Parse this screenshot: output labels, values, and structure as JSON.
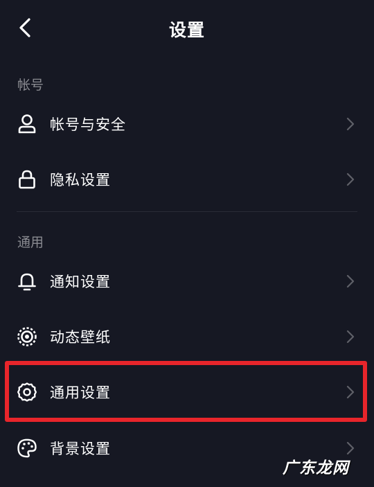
{
  "header": {
    "title": "设置"
  },
  "sections": {
    "account": {
      "label": "帐号",
      "items": [
        {
          "label": "帐号与安全",
          "icon": "user-icon"
        },
        {
          "label": "隐私设置",
          "icon": "lock-icon"
        }
      ]
    },
    "general": {
      "label": "通用",
      "items": [
        {
          "label": "通知设置",
          "icon": "bell-icon"
        },
        {
          "label": "动态壁纸",
          "icon": "live-wallpaper-icon"
        },
        {
          "label": "通用设置",
          "icon": "gear-icon",
          "highlighted": true
        },
        {
          "label": "背景设置",
          "icon": "palette-icon"
        }
      ]
    }
  },
  "watermark": "广东龙网",
  "colors": {
    "background": "#161823",
    "text": "#ffffff",
    "secondary_text": "#8a8b91",
    "chevron": "#5f6068",
    "highlight_border": "#e8252b"
  }
}
